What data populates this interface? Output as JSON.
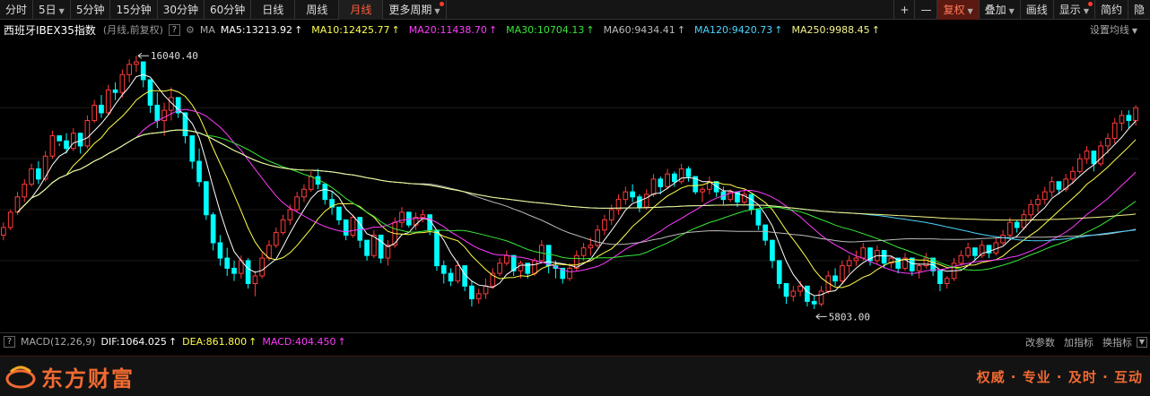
{
  "toolbar": {
    "left": [
      {
        "label": "分时",
        "active": false
      },
      {
        "label": "5日",
        "caret": true
      },
      {
        "label": "5分钟"
      },
      {
        "label": "15分钟"
      },
      {
        "label": "30分钟"
      },
      {
        "label": "60分钟"
      },
      {
        "label": "日线"
      },
      {
        "label": "周线"
      },
      {
        "label": "月线",
        "active": true
      },
      {
        "label": "更多周期",
        "caret": true,
        "dot": true
      }
    ],
    "right": [
      {
        "label": "+"
      },
      {
        "label": "—"
      },
      {
        "label": "复权",
        "caret": true,
        "red": true
      },
      {
        "label": "叠加",
        "caret": true
      },
      {
        "label": "画线"
      },
      {
        "label": "显示",
        "caret": true,
        "dot": true
      },
      {
        "label": "简约"
      },
      {
        "label": "隐"
      }
    ]
  },
  "info": {
    "title": "西班牙IBEX35指数",
    "subtitle": "(月线,前复权)",
    "help": "?",
    "ma_label": "MA",
    "ma": [
      {
        "text": "MA5:13213.92",
        "color": "#ffffff"
      },
      {
        "text": "MA10:12425.77",
        "color": "#ffff4c"
      },
      {
        "text": "MA20:11438.70",
        "color": "#ff3cff"
      },
      {
        "text": "MA30:10704.13",
        "color": "#38e838"
      },
      {
        "text": "MA60:9434.41",
        "color": "#bbbbbb"
      },
      {
        "text": "MA120:9420.73",
        "color": "#4cd4ff"
      },
      {
        "text": "MA250:9988.45",
        "color": "#f5f58a"
      }
    ],
    "arrow": "↑",
    "set_ma": "设置均线"
  },
  "annotations": {
    "high": "16040.40",
    "low": "5803.00"
  },
  "macd": {
    "name": "MACD(12,26,9)",
    "help": "?",
    "items": [
      {
        "text": "DIF:1064.025",
        "color": "#ffffff"
      },
      {
        "text": "DEA:861.800",
        "color": "#ffff4c"
      },
      {
        "text": "MACD:404.450",
        "color": "#ff3cff"
      }
    ],
    "links": [
      "改参数",
      "加指标",
      "换指标"
    ]
  },
  "footer": {
    "brand": "东方财富",
    "slogan": "权威 · 专业 · 及时 · 互动"
  },
  "colors": {
    "up": "#ff3b3b",
    "down": "#00ffff",
    "accent": "#f16a32"
  },
  "chart_data": {
    "type": "candlestick",
    "title": "西班牙IBEX35指数",
    "period": "月线",
    "ylim": [
      5500,
      16400
    ],
    "high_label": 16040.4,
    "low_label": 5803.0,
    "candles": [
      [
        9000,
        9500,
        8800,
        9300
      ],
      [
        9300,
        10000,
        9200,
        9900
      ],
      [
        9900,
        10700,
        9800,
        10500
      ],
      [
        10500,
        11200,
        10300,
        11000
      ],
      [
        11000,
        11800,
        10900,
        11600
      ],
      [
        11600,
        11900,
        11000,
        11200
      ],
      [
        11200,
        12300,
        11100,
        12100
      ],
      [
        12100,
        13100,
        12000,
        12900
      ],
      [
        12900,
        12600,
        12500,
        12700
      ],
      [
        12700,
        13000,
        12200,
        12400
      ],
      [
        12400,
        13200,
        12300,
        13000
      ],
      [
        13000,
        12900,
        12200,
        12500
      ],
      [
        12500,
        13700,
        12400,
        13500
      ],
      [
        13500,
        14300,
        13400,
        14100
      ],
      [
        14100,
        14500,
        13600,
        13800
      ],
      [
        13800,
        14900,
        13700,
        14700
      ],
      [
        14700,
        15000,
        14300,
        14600
      ],
      [
        14600,
        15500,
        14400,
        15300
      ],
      [
        15300,
        15900,
        15000,
        15700
      ],
      [
        15700,
        16040,
        15400,
        15800
      ],
      [
        15800,
        15600,
        14800,
        15100
      ],
      [
        15100,
        14500,
        13800,
        14100
      ],
      [
        14100,
        14600,
        13200,
        13500
      ],
      [
        13500,
        14200,
        12900,
        13900
      ],
      [
        13900,
        14800,
        13500,
        14400
      ],
      [
        14400,
        14200,
        13600,
        13800
      ],
      [
        13800,
        13600,
        12600,
        12900
      ],
      [
        12900,
        12800,
        11600,
        11900
      ],
      [
        11900,
        12400,
        10900,
        11100
      ],
      [
        11100,
        11000,
        9600,
        9800
      ],
      [
        9800,
        9900,
        8400,
        8700
      ],
      [
        8700,
        9000,
        7800,
        8100
      ],
      [
        8100,
        8500,
        7400,
        7700
      ],
      [
        7700,
        8000,
        7200,
        7500
      ],
      [
        7500,
        8200,
        7300,
        8000
      ],
      [
        8000,
        8100,
        6900,
        7100
      ],
      [
        7100,
        7600,
        6600,
        7400
      ],
      [
        7400,
        8300,
        7300,
        8100
      ],
      [
        8100,
        8800,
        8000,
        8600
      ],
      [
        8600,
        9300,
        8500,
        9100
      ],
      [
        9100,
        9800,
        9000,
        9600
      ],
      [
        9600,
        10200,
        9400,
        10000
      ],
      [
        10000,
        10700,
        9900,
        10500
      ],
      [
        10500,
        11000,
        10300,
        10800
      ],
      [
        10800,
        11500,
        10700,
        11300
      ],
      [
        11300,
        11600,
        10800,
        11000
      ],
      [
        11000,
        10900,
        10200,
        10400
      ],
      [
        10400,
        10700,
        9800,
        10100
      ],
      [
        10100,
        9900,
        9400,
        9600
      ],
      [
        9600,
        9500,
        8800,
        9000
      ],
      [
        9000,
        9800,
        8900,
        9700
      ],
      [
        9700,
        9600,
        8500,
        8800
      ],
      [
        8800,
        8700,
        8000,
        8200
      ],
      [
        8200,
        9200,
        8100,
        9000
      ],
      [
        9000,
        8900,
        7900,
        8100
      ],
      [
        8100,
        8800,
        7800,
        8600
      ],
      [
        8600,
        9700,
        8500,
        9500
      ],
      [
        9500,
        10100,
        9300,
        9900
      ],
      [
        9900,
        9800,
        9300,
        9400
      ],
      [
        9400,
        9900,
        9200,
        9700
      ],
      [
        9700,
        10000,
        9500,
        9800
      ],
      [
        9800,
        9700,
        9000,
        9200
      ],
      [
        9200,
        9100,
        7600,
        7800
      ],
      [
        7800,
        8000,
        7100,
        7500
      ],
      [
        7500,
        7700,
        7000,
        7200
      ],
      [
        7200,
        8000,
        7100,
        7800
      ],
      [
        7800,
        7700,
        6800,
        7000
      ],
      [
        7000,
        7200,
        6200,
        6500
      ],
      [
        6500,
        6900,
        6300,
        6700
      ],
      [
        6700,
        7300,
        6500,
        7000
      ],
      [
        7000,
        7700,
        6900,
        7500
      ],
      [
        7500,
        8100,
        7400,
        7900
      ],
      [
        7900,
        8400,
        7800,
        8200
      ],
      [
        8200,
        8100,
        7400,
        7600
      ],
      [
        7600,
        8000,
        7300,
        7900
      ],
      [
        7900,
        7800,
        7300,
        7500
      ],
      [
        7500,
        8100,
        7400,
        8000
      ],
      [
        8000,
        8800,
        7900,
        8600
      ],
      [
        8600,
        8500,
        7500,
        7800
      ],
      [
        7800,
        8000,
        7300,
        7700
      ],
      [
        7700,
        7600,
        7100,
        7300
      ],
      [
        7300,
        7900,
        7200,
        7700
      ],
      [
        7700,
        8400,
        7600,
        8200
      ],
      [
        8200,
        8700,
        8000,
        8500
      ],
      [
        8500,
        8900,
        8200,
        8600
      ],
      [
        8600,
        9400,
        8500,
        9200
      ],
      [
        9200,
        9800,
        9000,
        9600
      ],
      [
        9600,
        10200,
        9400,
        10000
      ],
      [
        10000,
        10600,
        9800,
        10400
      ],
      [
        10400,
        10900,
        10200,
        10700
      ],
      [
        10700,
        11000,
        10300,
        10500
      ],
      [
        10500,
        10600,
        9900,
        10100
      ],
      [
        10100,
        10800,
        10000,
        10600
      ],
      [
        10600,
        11400,
        10500,
        11200
      ],
      [
        11200,
        11300,
        10600,
        10900
      ],
      [
        10900,
        11600,
        10800,
        11400
      ],
      [
        11400,
        11500,
        10900,
        11100
      ],
      [
        11100,
        11800,
        11000,
        11600
      ],
      [
        11600,
        11700,
        11100,
        11300
      ],
      [
        11300,
        11000,
        10600,
        10700
      ],
      [
        10700,
        10900,
        10300,
        10800
      ],
      [
        10800,
        11300,
        10600,
        11100
      ],
      [
        11100,
        11100,
        10500,
        10700
      ],
      [
        10700,
        10900,
        10200,
        10400
      ],
      [
        10400,
        10800,
        10300,
        10700
      ],
      [
        10700,
        10600,
        10100,
        10300
      ],
      [
        10300,
        10800,
        10200,
        10600
      ],
      [
        10600,
        10500,
        9800,
        10000
      ],
      [
        10000,
        9700,
        9200,
        9400
      ],
      [
        9400,
        9300,
        8600,
        8800
      ],
      [
        8800,
        8500,
        7700,
        8000
      ],
      [
        8000,
        7800,
        6900,
        7100
      ],
      [
        7100,
        7000,
        6300,
        6600
      ],
      [
        6600,
        7000,
        6400,
        6800
      ],
      [
        6800,
        7200,
        6600,
        7000
      ],
      [
        7000,
        6900,
        6200,
        6400
      ],
      [
        6400,
        6600,
        6100,
        6300
      ],
      [
        6300,
        7000,
        6200,
        6800
      ],
      [
        6800,
        7600,
        6700,
        7400
      ],
      [
        7400,
        7700,
        7000,
        7200
      ],
      [
        7200,
        8000,
        7100,
        7800
      ],
      [
        7800,
        8200,
        7500,
        8000
      ],
      [
        8000,
        8400,
        7800,
        8100
      ],
      [
        8100,
        8700,
        8000,
        8500
      ],
      [
        8500,
        8300,
        7800,
        8000
      ],
      [
        8000,
        8600,
        7900,
        8400
      ],
      [
        8400,
        8300,
        7700,
        7900
      ],
      [
        7900,
        8200,
        7700,
        8100
      ],
      [
        8100,
        8000,
        7500,
        7700
      ],
      [
        7700,
        8300,
        7600,
        8100
      ],
      [
        8100,
        7900,
        7400,
        7600
      ],
      [
        7600,
        7900,
        7300,
        7800
      ],
      [
        7800,
        8300,
        7700,
        8100
      ],
      [
        8100,
        8000,
        7400,
        7600
      ],
      [
        7600,
        7500,
        6800,
        7100
      ],
      [
        7100,
        7400,
        6900,
        7300
      ],
      [
        7300,
        8100,
        7200,
        7900
      ],
      [
        7900,
        8400,
        7800,
        8200
      ],
      [
        8200,
        8700,
        8100,
        8500
      ],
      [
        8500,
        8400,
        8000,
        8200
      ],
      [
        8200,
        8800,
        8100,
        8600
      ],
      [
        8600,
        8500,
        8100,
        8300
      ],
      [
        8300,
        8900,
        8200,
        8700
      ],
      [
        8700,
        9200,
        8600,
        9000
      ],
      [
        9000,
        9700,
        8900,
        9500
      ],
      [
        9500,
        9600,
        9100,
        9300
      ],
      [
        9300,
        10000,
        9200,
        9800
      ],
      [
        9800,
        10400,
        9600,
        10200
      ],
      [
        10200,
        10600,
        9900,
        10400
      ],
      [
        10400,
        10900,
        10200,
        10700
      ],
      [
        10700,
        11300,
        10500,
        11100
      ],
      [
        11100,
        11000,
        10600,
        10800
      ],
      [
        10800,
        11400,
        10700,
        11200
      ],
      [
        11200,
        11700,
        11000,
        11500
      ],
      [
        11500,
        12200,
        11400,
        12000
      ],
      [
        12000,
        12500,
        11800,
        12300
      ],
      [
        12300,
        12100,
        11500,
        11800
      ],
      [
        11800,
        12700,
        11700,
        12500
      ],
      [
        12500,
        13000,
        12200,
        12800
      ],
      [
        12800,
        13600,
        12600,
        13400
      ],
      [
        13400,
        13900,
        13100,
        13700
      ],
      [
        13700,
        13900,
        13200,
        13500
      ],
      [
        13500,
        14100,
        13300,
        14000
      ]
    ]
  }
}
